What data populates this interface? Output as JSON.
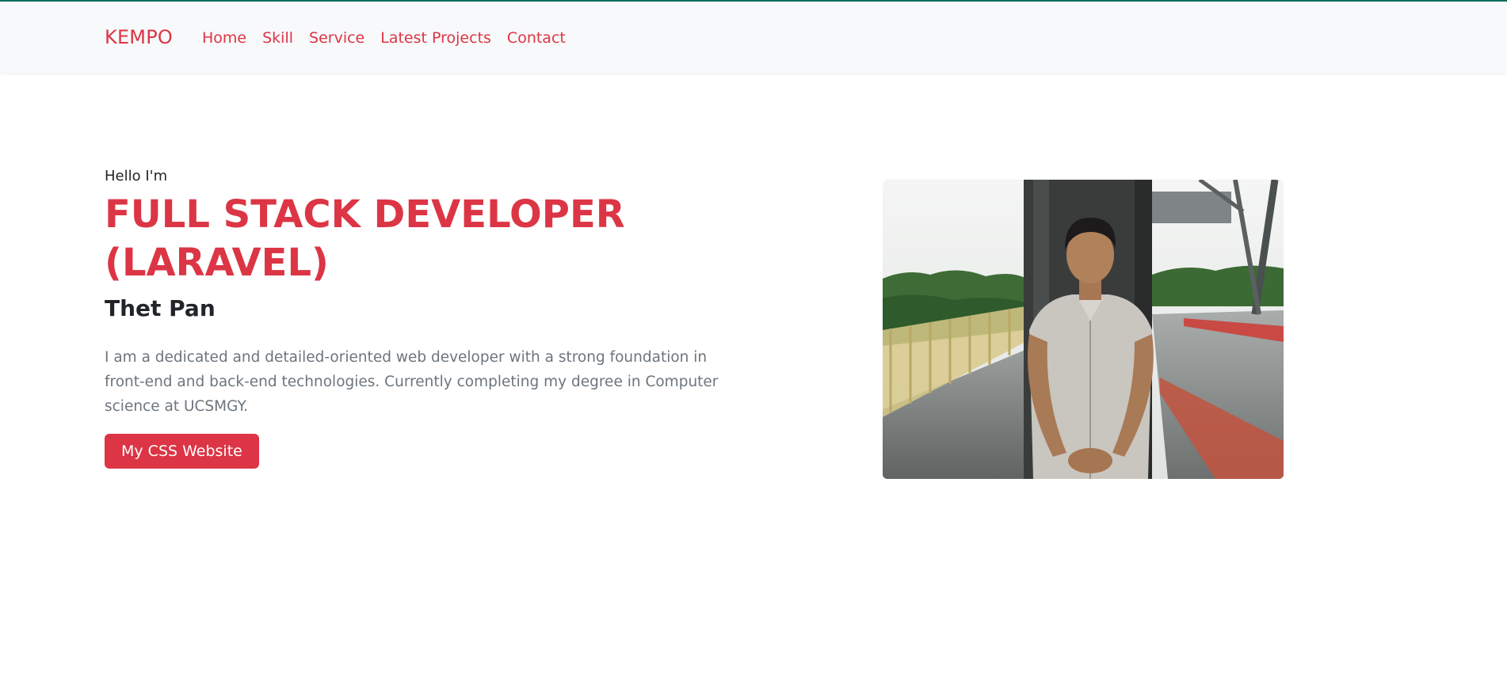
{
  "navbar": {
    "brand": "KEMPO",
    "links": [
      {
        "label": "Home"
      },
      {
        "label": "Skill"
      },
      {
        "label": "Service"
      },
      {
        "label": "Latest Projects"
      },
      {
        "label": "Contact"
      }
    ]
  },
  "hero": {
    "greeting": "Hello I'm",
    "headline_line1": "FULL STACK DEVELOPER",
    "headline_line2": "(LARAVEL)",
    "name": "Thet Pan",
    "description": "I am a dedicated and detailed-oriented web developer with a strong foundation in front-end and back-end technologies. Currently completing my degree in Computer science at UCSMGY.",
    "button_label": "My CSS Website"
  },
  "colors": {
    "accent": "#dc3545",
    "navbar_bg": "#f8f9fa",
    "top_border": "#0f6e5e",
    "text_dark": "#212529",
    "text_muted": "#6c757d"
  }
}
